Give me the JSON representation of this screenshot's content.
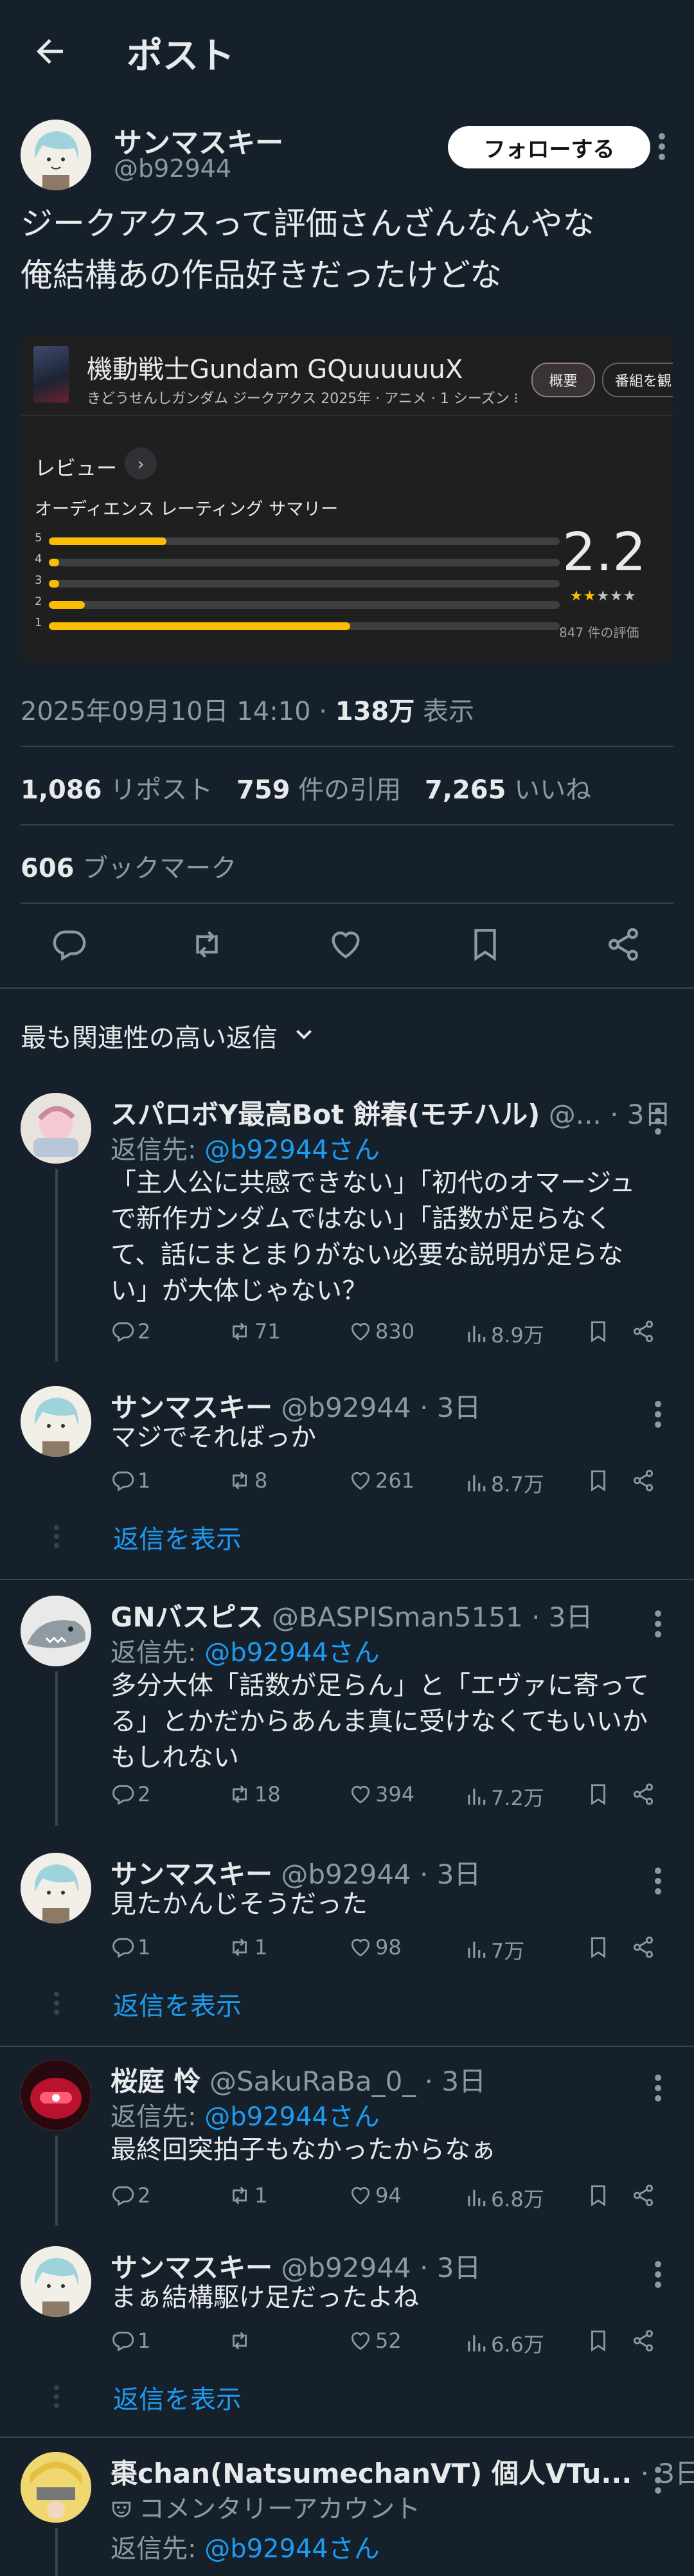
{
  "header": {
    "title": "ポスト"
  },
  "post": {
    "author_name": "サンマスキー",
    "author_handle": "@b92944",
    "follow_label": "フォローする",
    "text": "ジークアクスって評価さんざんなんやな\n俺結構あの作品好きだったけどな",
    "timestamp": "2025年09月10日 14:10 · ",
    "views_value": "138万",
    "views_label": " 表示",
    "reposts_value": "1,086",
    "reposts_label": " リポスト",
    "quotes_value": "759",
    "quotes_label": " 件の引用",
    "likes_value": "7,265",
    "likes_label": " いいね",
    "bookmarks_value": "606",
    "bookmarks_label": " ブックマーク"
  },
  "media": {
    "title": "機動戦士Gundam GQuuuuuuX",
    "meta": "きどうせんしガンダム ジークアクス  2025年 · アニメ · 1 シーズン  ⁝",
    "tab_overview": "概要",
    "tab_program": "番組を観",
    "review_label": "レビュー",
    "summary_label": "オーディエンス レーティング サマリー",
    "rating": "2.2",
    "rating_count": "847 件の評価",
    "stars": "★★★★★",
    "bars": [
      {
        "label": "5",
        "fraction": 0.23
      },
      {
        "label": "4",
        "fraction": 0.02
      },
      {
        "label": "3",
        "fraction": 0.02
      },
      {
        "label": "2",
        "fraction": 0.07
      },
      {
        "label": "1",
        "fraction": 0.59
      }
    ]
  },
  "sort_label": "最も関連性の高い返信",
  "show_replies_label": "返信を表示",
  "replies": [
    {
      "name": "スパロボY最高Bot 餅春(モチハル)",
      "handle": " @...",
      "time": " · 3日",
      "reply_to_prefix": "返信先: ",
      "reply_to": "@b92944さん",
      "text": "「主人公に共感できない」「初代のオマージュで新作ガンダムではない」「話数が足らなくて、話にまとまりがない必要な説明が足らない」が大体じゃない？",
      "replies": "2",
      "reposts": "71",
      "likes": "830",
      "views": "8.9万"
    },
    {
      "name": "サンマスキー",
      "handle": " @b92944",
      "time": " · 3日",
      "text": "マジでそればっか",
      "replies": "1",
      "reposts": "8",
      "likes": "261",
      "views": "8.7万"
    },
    {
      "name": "GNバスピス",
      "handle": " @BASPISman5151",
      "time": " · 3日",
      "reply_to_prefix": "返信先: ",
      "reply_to": "@b92944さん",
      "text": "多分大体「話数が足らん」と「エヴァに寄ってる」とかだからあんま真に受けなくてもいいかもしれない",
      "replies": "2",
      "reposts": "18",
      "likes": "394",
      "views": "7.2万"
    },
    {
      "name": "サンマスキー",
      "handle": " @b92944",
      "time": " · 3日",
      "text": "見たかんじそうだった",
      "replies": "1",
      "reposts": "1",
      "likes": "98",
      "views": "7万"
    },
    {
      "name": "桜庭 怜",
      "handle": " @SakuRaBa_0_",
      "time": " · 3日",
      "reply_to_prefix": "返信先: ",
      "reply_to": "@b92944さん",
      "text": "最終回突拍子もなかったからなぁ",
      "replies": "2",
      "reposts": "1",
      "likes": "94",
      "views": "6.8万"
    },
    {
      "name": "サンマスキー",
      "handle": " @b92944",
      "time": " · 3日",
      "text": "まぁ結構駆け足だったよね",
      "replies": "1",
      "reposts": "",
      "likes": "52",
      "views": "6.6万"
    },
    {
      "name": "棗chan(NatsumechanVT) 個人VTu...",
      "handle": "",
      "time": " · 3日",
      "community": "コメンタリーアカウント",
      "reply_to_prefix": "返信先: ",
      "reply_to": "@b92944さん"
    }
  ],
  "colors": {
    "background": "#15202b",
    "accent": "#1d9bf0",
    "star": "#fbbc04"
  }
}
